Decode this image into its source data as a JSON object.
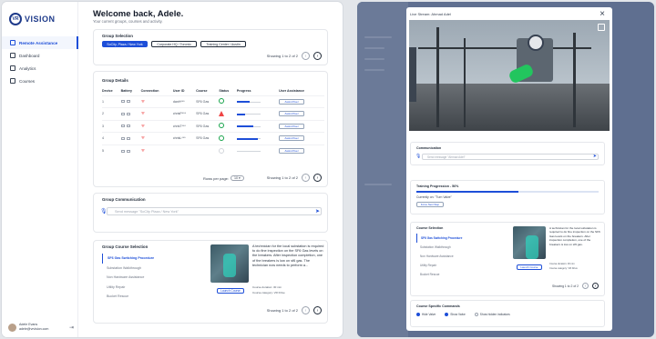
{
  "brand": {
    "logo_mark": "VR",
    "logo_text": "VISION"
  },
  "sidebar": {
    "items": [
      {
        "label": "Remote Assistance",
        "icon": "monitor-icon",
        "active": true
      },
      {
        "label": "Dashboard",
        "icon": "grid-icon",
        "active": false
      },
      {
        "label": "Analytics",
        "icon": "chart-icon",
        "active": false
      },
      {
        "label": "Courses",
        "icon": "book-icon",
        "active": false
      }
    ],
    "user": {
      "name": "Adele Evans",
      "email": "adele@vrvision.com"
    }
  },
  "header": {
    "title": "Welcome back, Adele.",
    "subtitle": "Your current groups, courses and activity."
  },
  "group_selection": {
    "title": "Group Selection",
    "chips": [
      {
        "label": "SoCity, Plaza / New York",
        "selected": true
      },
      {
        "label": "Corporate HQ / Toronto",
        "selected": false
      },
      {
        "label": "Training Center / Austin",
        "selected": false
      }
    ],
    "pager": "Showing 1 to 2 of 2"
  },
  "group_details": {
    "title": "Group Details",
    "columns": [
      "Device",
      "Battery",
      "Connection",
      "User ID",
      "Course",
      "Status",
      "Progress",
      "User Assistance"
    ],
    "rows": [
      {
        "device": "1",
        "user": "danH***",
        "course": "SF6 Gas",
        "status": "ok",
        "progress": 0.55,
        "assist": "Assist Peer"
      },
      {
        "device": "2",
        "user": "chrisP***",
        "course": "SF6 Gas",
        "status": "warn",
        "progress": 0.35,
        "assist": "Assist Peer"
      },
      {
        "device": "3",
        "user": "chrisT***",
        "course": "SF6 Gas",
        "status": "ok",
        "progress": 0.7,
        "assist": "Assist Peer"
      },
      {
        "device": "4",
        "user": "chrisL***",
        "course": "SF6 Gas",
        "status": "ok",
        "progress": 0.9,
        "assist": "Assist Peer"
      },
      {
        "device": "5",
        "user": "",
        "course": "",
        "status": "empty",
        "progress": 0,
        "assist": "Assist Peer"
      }
    ],
    "rows_per_page_label": "Rows per page:",
    "rows_per_page_value": "10",
    "pager": "Showing 1 to 2 of 2"
  },
  "group_communication": {
    "title": "Group Communication",
    "placeholder": "Send message \"SoCity Plaza / New York\""
  },
  "group_course_selection": {
    "title": "Group Course Selection",
    "courses": [
      {
        "label": "SF6 Gas Switching Procedure",
        "selected": true
      },
      {
        "label": "Substation Walkthrough",
        "selected": false
      },
      {
        "label": "Non Hardware Assistance",
        "selected": false
      },
      {
        "label": "Utility Repair",
        "selected": false
      },
      {
        "label": "Bucket Rescue",
        "selected": false
      }
    ],
    "description": "A technician for the local substation is required to do fine inspection on the SF6 Gas levels on the breakers. After inspection completion, one of the breakers is low on sf6 gas. The technician now needs to perform a...",
    "launch_label": "Launch Course",
    "meta": [
      "Course duration: 30 min",
      "Course category: VR Drive"
    ],
    "pager": "Showing 1 to 2 of 2"
  },
  "modal": {
    "title": "Live Stream: Ahmad Adel",
    "communication": {
      "title": "Communication",
      "placeholder": "Send message \"Ahmad Adel\""
    },
    "training": {
      "title": "Training Progression - 56%",
      "percent": 0.56,
      "current": "Currently on: \"Turn Valve\"",
      "button": "Force Next Step"
    },
    "course_selection": {
      "title": "Course Selection",
      "courses": [
        {
          "label": "SF6 Gas Switching Procedure",
          "selected": true
        },
        {
          "label": "Substation Walkthrough",
          "selected": false
        },
        {
          "label": "Non Hardware Assistance",
          "selected": false
        },
        {
          "label": "Utility Repair",
          "selected": false
        },
        {
          "label": "Bucket Rescue",
          "selected": false
        }
      ],
      "description": "A technician for the local substation is required to do fine inspection on the SF6 Gas levels on the breakers. After inspection completion, one of the breakers is low on sf6 gas.",
      "launch_label": "Launch Course",
      "meta": [
        "Course duration: 30 min",
        "Course category: VR Drive"
      ],
      "pager": "Showing 1 to 2 of 2"
    },
    "commands": {
      "title": "Course Specific Commands",
      "options": [
        {
          "label": "Hide Valve",
          "on": true
        },
        {
          "label": "Show Valve",
          "on": true
        },
        {
          "label": "Show hidden indicators",
          "on": false
        }
      ]
    }
  },
  "colors": {
    "accent": "#1d4ed8",
    "dim_overlay": "#5f6f90",
    "success": "#16a34a",
    "danger": "#ef4444"
  }
}
